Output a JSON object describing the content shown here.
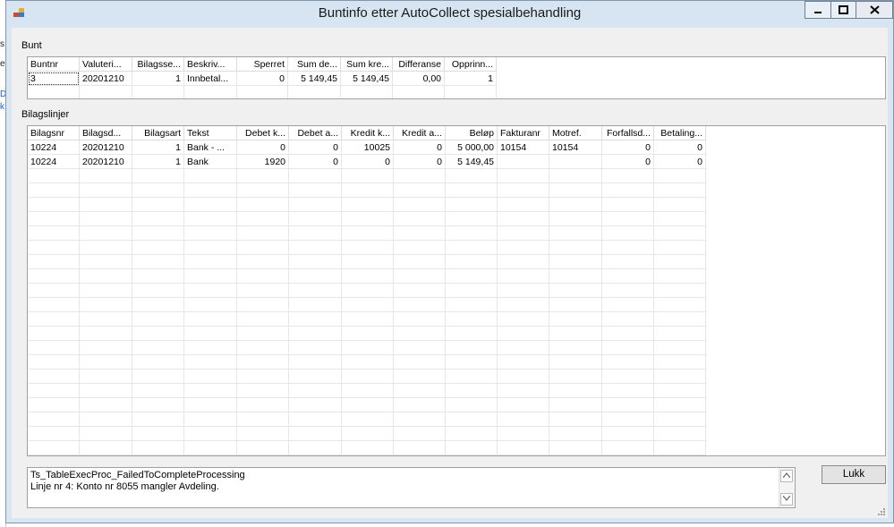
{
  "window": {
    "title": "Buntinfo etter AutoCollect spesialbehandling"
  },
  "behind": {
    "fragments": [
      "s",
      "e",
      "D",
      "k"
    ]
  },
  "bunt": {
    "label": "Bunt",
    "columns": [
      "Buntnr",
      "Valuteri...",
      "Bilagsse...",
      "Beskriv...",
      "Sperret",
      "Sum de...",
      "Sum kre...",
      "Differanse",
      "Opprinn..."
    ],
    "rows": [
      [
        "3",
        "20201210",
        "1",
        "Innbetal...",
        "0",
        "5 149,45",
        "5 149,45",
        "0,00",
        "1"
      ]
    ]
  },
  "bilagslinjer": {
    "label": "Bilagslinjer",
    "columns": [
      "Bilagsnr",
      "Bilagsd...",
      "Bilagsart",
      "Tekst",
      "Debet k...",
      "Debet a...",
      "Kredit k...",
      "Kredit a...",
      "Beløp",
      "Fakturanr",
      "Motref.",
      "Forfallsd...",
      "Betaling..."
    ],
    "rows": [
      [
        "10224",
        "20201210",
        "1",
        "Bank - ...",
        "0",
        "0",
        "10025",
        "0",
        "5 000,00",
        "10154",
        "10154",
        "0",
        "0"
      ],
      [
        "10224",
        "20201210",
        "1",
        "Bank",
        "1920",
        "0",
        "0",
        "0",
        "5 149,45",
        "",
        "",
        "0",
        "0"
      ]
    ]
  },
  "message": {
    "lines": [
      "Ts_TableExecProc_FailedToCompleteProcessing",
      "Linje nr 4: Konto nr 8055 mangler Avdeling."
    ]
  },
  "buttons": {
    "lukk": "Lukk"
  },
  "icons": {
    "app": "app-window-icon",
    "minimize": "minimize-icon",
    "maximize": "maximize-icon",
    "close": "close-icon",
    "scroll_up": "scroll-up-icon",
    "scroll_down": "scroll-down-icon",
    "grip": "resize-grip-icon"
  },
  "colors": {
    "titlebar": "#d7e4f1",
    "frame": "#7e97b0",
    "client": "#f0f0f0"
  }
}
